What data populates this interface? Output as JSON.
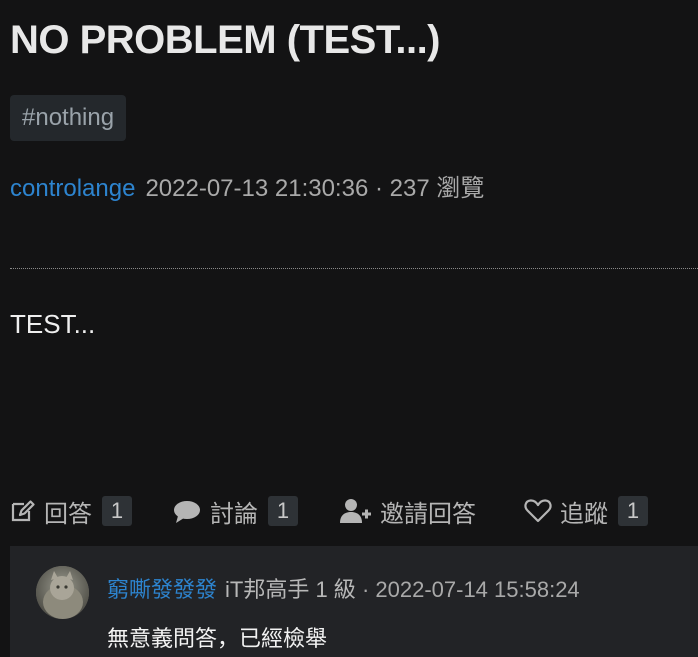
{
  "question": {
    "title": "NO PROBLEM (TEST...)",
    "tag": "#nothing",
    "author": "controlange",
    "datetime": "2022-07-13 21:30:36",
    "views": "· 237 瀏覽",
    "body": "TEST..."
  },
  "actions": {
    "answer_label": "回答",
    "answer_count": "1",
    "discuss_label": "討論",
    "discuss_count": "1",
    "invite_label": "邀請回答",
    "follow_label": "追蹤",
    "follow_count": "1"
  },
  "comment": {
    "author": "窮嘶發發發",
    "rank": "iT邦高手 1 級",
    "datetime": "· 2022-07-14 15:58:24",
    "text": "無意義問答，已經檢舉"
  },
  "colors": {
    "background": "#131314",
    "link": "#2d84cf",
    "tag_bg": "#24282c",
    "comment_bg": "#222326"
  },
  "icons": [
    "edit-icon",
    "comment-bubble-icon",
    "user-plus-icon",
    "heart-icon"
  ]
}
